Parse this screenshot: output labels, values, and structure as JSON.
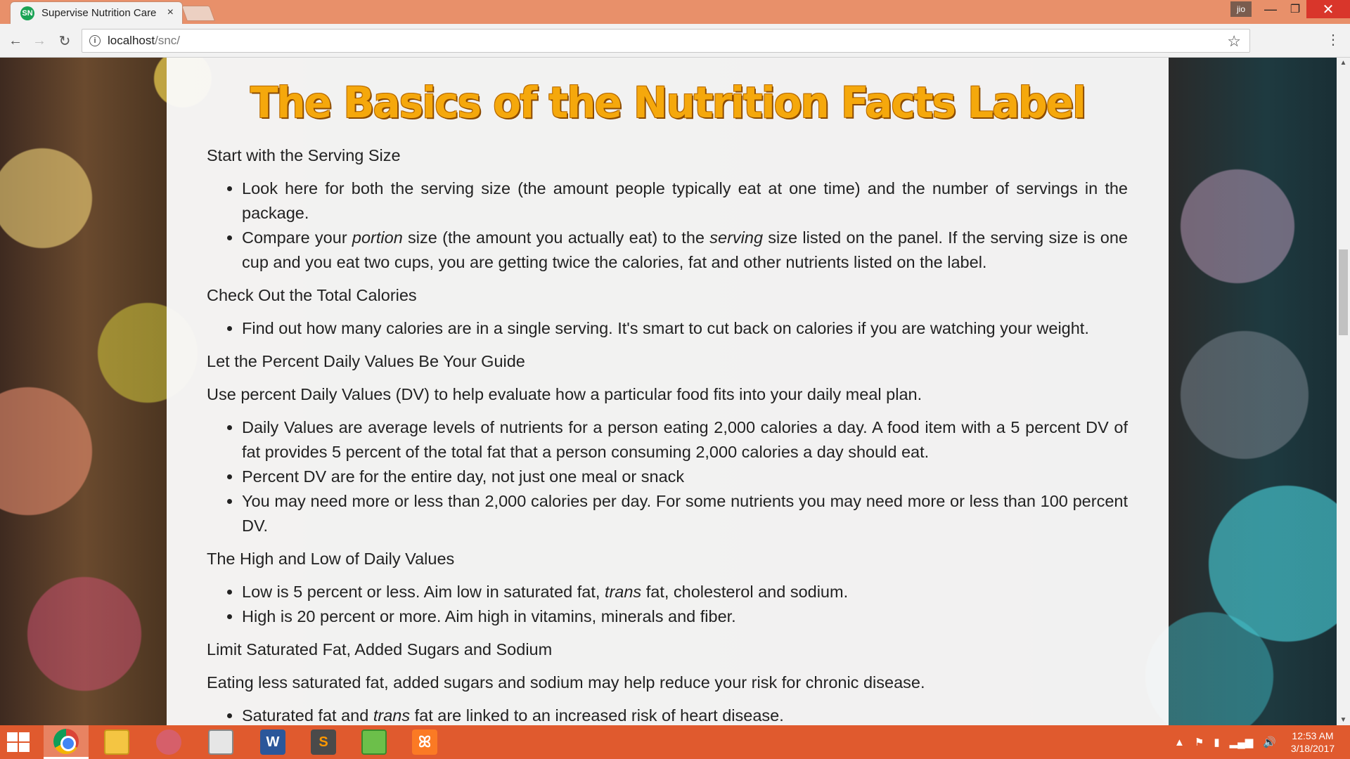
{
  "browser": {
    "tab_title": "Supervise Nutrition Care",
    "tab_favicon": "SN",
    "tab_close": "×",
    "profile": "jio",
    "url_host": "localhost",
    "url_path": "/snc/",
    "icons": [
      "back-arrow-icon",
      "forward-arrow-icon",
      "reload-icon",
      "info-icon",
      "star-icon",
      "menu-icon"
    ]
  },
  "page": {
    "title": "The Basics of the Nutrition Facts Label",
    "s1_heading": "Start with the Serving Size",
    "s1_b1": "Look here for both the serving size (the amount people typically eat at one time) and the number of servings in the package.",
    "s1_b2_a": "Compare your ",
    "s1_b2_em1": "portion",
    "s1_b2_b": " size (the amount you actually eat) to the ",
    "s1_b2_em2": "serving",
    "s1_b2_c": " size listed on the panel. If the serving size is one cup and you eat two cups, you are getting twice the calories, fat and other nutrients listed on the label.",
    "s2_heading": "Check Out the Total Calories",
    "s2_b1": "Find out how many calories are in a single serving. It's smart to cut back on calories if you are watching your weight.",
    "s3_heading": "Let the Percent Daily Values Be Your Guide",
    "s3_intro": "Use percent Daily Values (DV) to help evaluate how a particular food fits into your daily meal plan.",
    "s3_b1": "Daily Values are average levels of nutrients for a person eating 2,000 calories a day. A food item with a 5 percent DV of fat provides 5 percent of the total fat that a person consuming 2,000 calories a day should eat.",
    "s3_b2": "Percent DV are for the entire day, not just one meal or snack",
    "s3_b3": "You may need more or less than 2,000 calories per day. For some nutrients you may need more or less than 100 percent DV.",
    "s4_heading": "The High and Low of Daily Values",
    "s4_b1_a": "Low is 5 percent or less. Aim low in saturated fat, ",
    "s4_b1_em": "trans",
    "s4_b1_b": " fat, cholesterol and sodium.",
    "s4_b2": "High is 20 percent or more. Aim high in vitamins, minerals and fiber.",
    "s5_heading": "Limit Saturated Fat, Added Sugars and Sodium",
    "s5_intro": "Eating less saturated fat, added sugars and sodium may help reduce your risk for chronic disease.",
    "s5_b1_a": "Saturated fat and ",
    "s5_b1_em": "trans",
    "s5_b1_b": " fat are linked to an increased risk of heart disease."
  },
  "taskbar": {
    "word_label": "W",
    "sublime_label": "S",
    "xampp_label": "ꕤ",
    "time": "12:53 AM",
    "date": "3/18/2017"
  }
}
